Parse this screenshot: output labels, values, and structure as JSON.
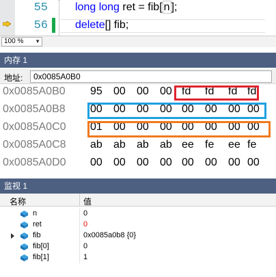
{
  "editor": {
    "lines": [
      {
        "number": "55",
        "code_type": "long long",
        "code_rest": " ret = fib[",
        "code_boxed": "n",
        "code_end": "];"
      },
      {
        "number": "56",
        "code_kw": "delete",
        "code_rest": "[] fib;"
      }
    ],
    "current_line_arrow": "arrow-icon",
    "colors": {
      "line_number": "#2b91af",
      "keyword": "#0000ff",
      "changed_bar": "#1aa84a"
    }
  },
  "zoom": {
    "value": "100 %"
  },
  "memory_window": {
    "title": "内存 1",
    "address_label": "地址:",
    "address_value": "0x0085A0B0",
    "rows": [
      {
        "address": "0x0085A0B0",
        "bytes": [
          "95",
          "00",
          "00",
          "00",
          "fd",
          "fd",
          "fd",
          "fd"
        ]
      },
      {
        "address": "0x0085A0B8",
        "bytes": [
          "00",
          "00",
          "00",
          "00",
          "00",
          "00",
          "00",
          "00"
        ]
      },
      {
        "address": "0x0085A0C0",
        "bytes": [
          "01",
          "00",
          "00",
          "00",
          "00",
          "00",
          "00",
          "00"
        ]
      },
      {
        "address": "0x0085A0C8",
        "bytes": [
          "ab",
          "ab",
          "ab",
          "ab",
          "ee",
          "fe",
          "ee",
          "fe"
        ]
      },
      {
        "address": "0x0085A0D0",
        "bytes": [
          "00",
          "00",
          "00",
          "00",
          "00",
          "00",
          "00",
          "00"
        ]
      }
    ],
    "highlight_colors": {
      "red": "#e0242e",
      "blue": "#1ea0e0",
      "orange": "#f07a1e"
    }
  },
  "watch_window": {
    "title": "监视 1",
    "columns": {
      "name": "名称",
      "value": "值"
    },
    "rows": [
      {
        "name": "n",
        "value": "0",
        "value_color": "#000000",
        "expandable": false
      },
      {
        "name": "ret",
        "value": "0",
        "value_color": "#e00000",
        "expandable": false
      },
      {
        "name": "fib",
        "value": "0x0085a0b8 {0}",
        "value_color": "#000000",
        "expandable": true
      },
      {
        "name": "fib[0]",
        "value": "0",
        "value_color": "#000000",
        "expandable": false
      },
      {
        "name": "fib[1]",
        "value": "1",
        "value_color": "#000000",
        "expandable": false
      }
    ]
  }
}
